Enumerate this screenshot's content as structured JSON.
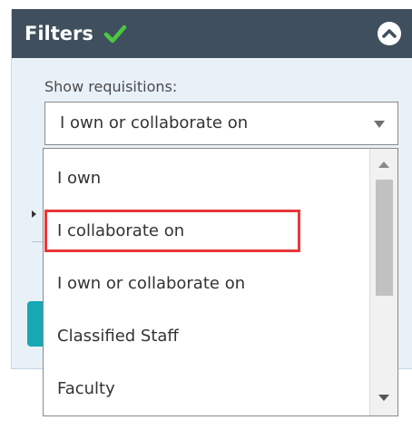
{
  "panel": {
    "title": "Filters",
    "title_icon": "check-icon",
    "collapse_icon": "chevron-up-circle-icon",
    "colors": {
      "header": "#3f4f5d",
      "check": "#4cc742",
      "highlight": "#e8373a",
      "accent": "#17a8b4"
    }
  },
  "filter": {
    "label": "Show requisitions:",
    "selected_value": "I own or collaborate on"
  },
  "dropdown": {
    "options": [
      {
        "label": "I own"
      },
      {
        "label": "I collaborate on"
      },
      {
        "label": "I own or collaborate on"
      },
      {
        "label": "Classified Staff"
      },
      {
        "label": "Faculty"
      }
    ],
    "highlighted_option": "I collaborate on"
  }
}
